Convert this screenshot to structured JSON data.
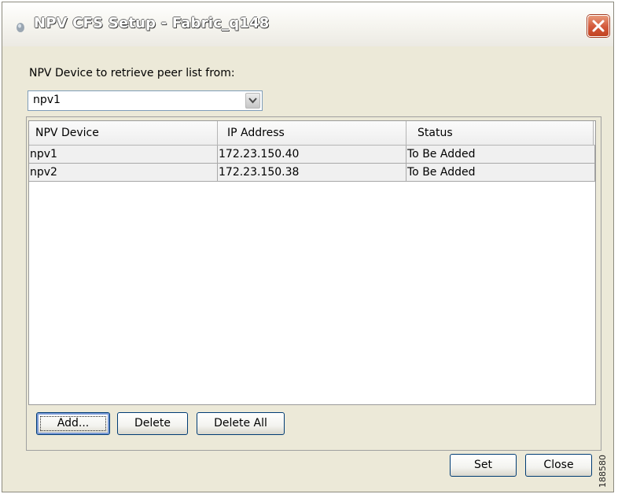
{
  "window": {
    "title": "NPV CFS Setup - Fabric_q148"
  },
  "retrieve": {
    "label": "NPV Device to retrieve peer list from:",
    "selected": "npv1"
  },
  "table": {
    "columns": [
      "NPV Device",
      "IP Address",
      "Status"
    ],
    "rows": [
      [
        "npv1",
        "172.23.150.40",
        "To Be Added"
      ],
      [
        "npv2",
        "172.23.150.38",
        "To Be Added"
      ]
    ]
  },
  "buttons": {
    "add": "Add...",
    "delete": "Delete",
    "delete_all": "Delete All",
    "set": "Set",
    "close": "Close"
  },
  "side_number": "188580",
  "icons": {
    "title": "app-window-icon",
    "close": "close-x-icon",
    "combo": "chevron-down-icon"
  }
}
